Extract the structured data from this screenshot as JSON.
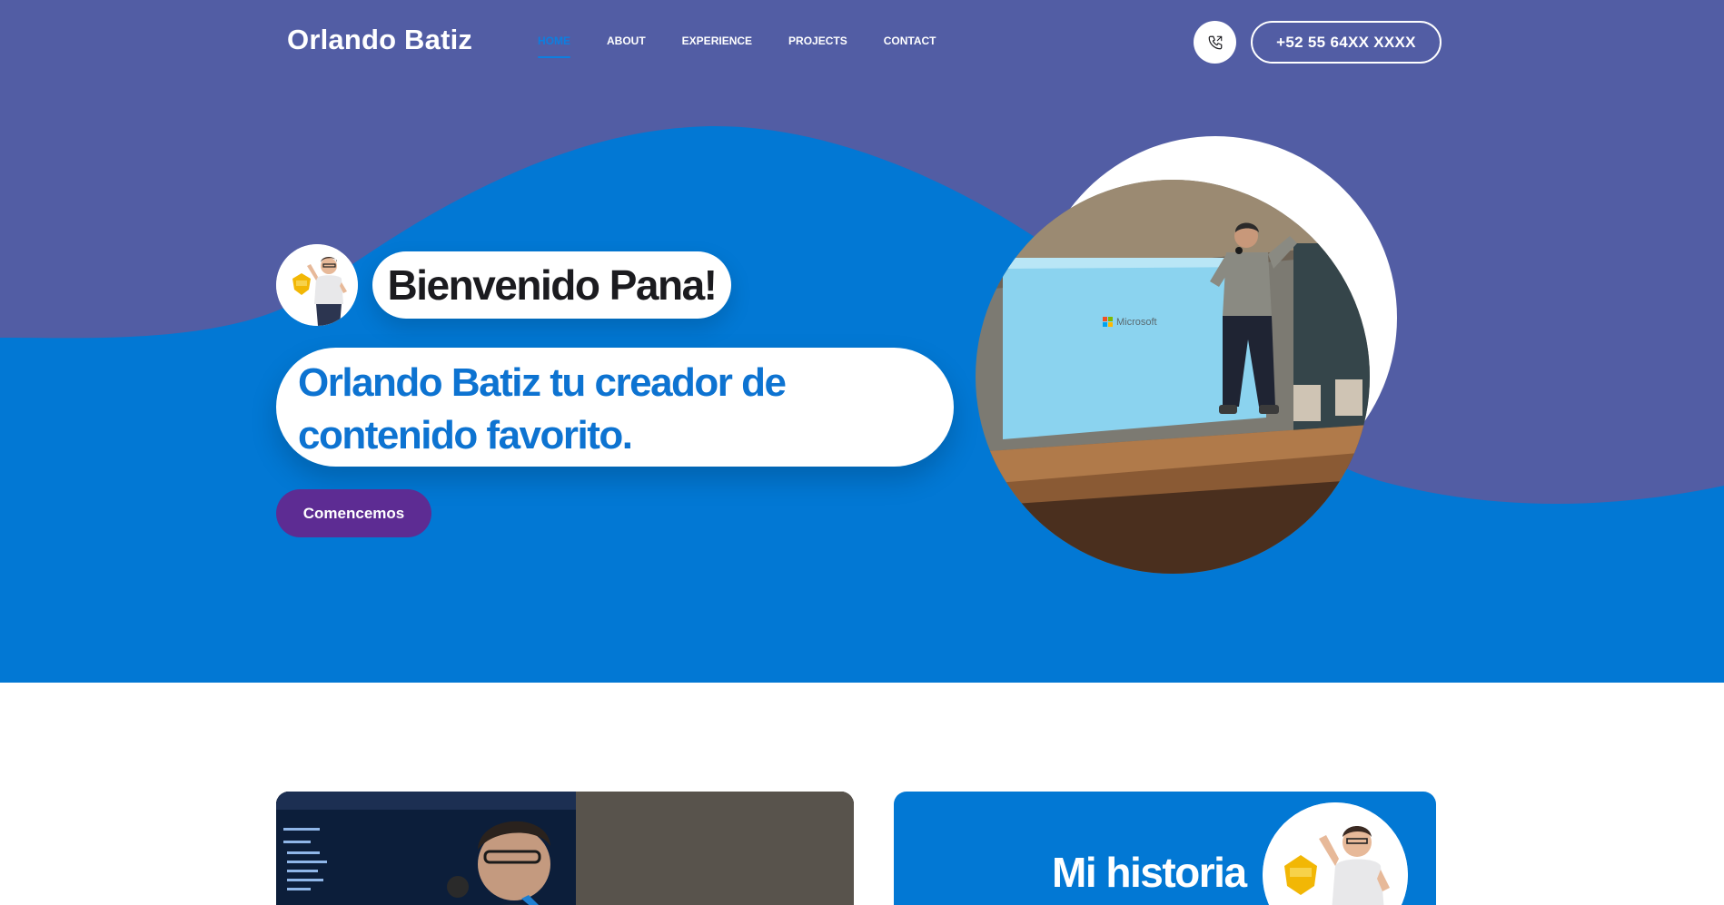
{
  "header": {
    "brand": "Orlando Batiz",
    "nav": [
      {
        "label": "HOME"
      },
      {
        "label": "ABOUT"
      },
      {
        "label": "EXPERIENCE"
      },
      {
        "label": "PROJECTS"
      },
      {
        "label": "CONTACT"
      }
    ],
    "phone_icon": "phone-icon",
    "phone_label": "+52 55 64XX XXXX"
  },
  "hero": {
    "greeting": "Bienvenido Pana!",
    "headline": "Orlando Batiz tu creador de contenido favorito.",
    "cta_label": "Comencemos",
    "photo_screen_text": "Microsoft"
  },
  "story": {
    "title": "Mi historia"
  },
  "colors": {
    "hero_blue": "#0278d4",
    "wave_purple": "#525da4",
    "cta_purple": "#5d2c93",
    "headline_blue": "#0d73d1",
    "nav_active": "#0d7fe0"
  }
}
